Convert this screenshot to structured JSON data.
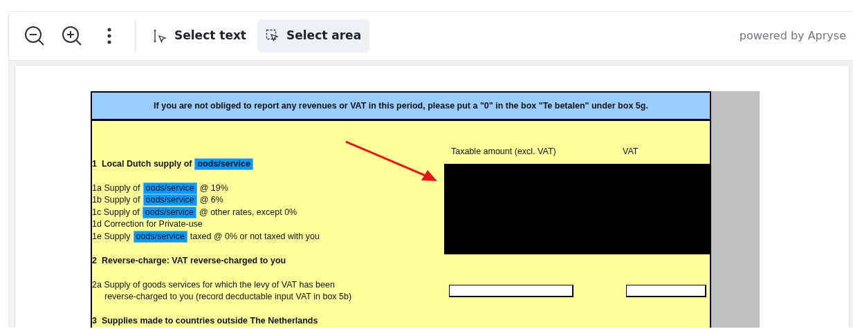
{
  "toolbar": {
    "tools": [
      {
        "label": "Select text",
        "kind": "text",
        "selected": false
      },
      {
        "label": "Select area",
        "kind": "area",
        "selected": true
      }
    ],
    "branding": "powered by Apryse"
  },
  "document": {
    "notice": "If you are not obliged to report any revenues or VAT in this period, please put a \"0\" in the box \"Te betalen\" under box 5g.",
    "columns": [
      "Taxable amount (excl. VAT)",
      "VAT"
    ],
    "redacted": true,
    "items": [
      {
        "kind": "heading",
        "parts": [
          {
            "text": "1  Local Dutch supply of",
            "highlight": false
          },
          {
            "text": "oods/service",
            "highlight": true
          }
        ]
      },
      {
        "kind": "line",
        "parts": [
          {
            "text": "1a Supply of",
            "highlight": false
          },
          {
            "text": "oods/service",
            "highlight": true
          },
          {
            "text": "@ 19%",
            "highlight": false
          }
        ]
      },
      {
        "kind": "line",
        "parts": [
          {
            "text": "1b Supply of",
            "highlight": false
          },
          {
            "text": "oods/service",
            "highlight": true
          },
          {
            "text": "@ 6%",
            "highlight": false
          }
        ]
      },
      {
        "kind": "line",
        "parts": [
          {
            "text": "1c Supply of",
            "highlight": false
          },
          {
            "text": "oods/service",
            "highlight": true
          },
          {
            "text": "@ other rates, except 0%",
            "highlight": false
          }
        ]
      },
      {
        "kind": "line",
        "parts": [
          {
            "text": "1d Correction for Private-use",
            "highlight": false
          }
        ]
      },
      {
        "kind": "line",
        "parts": [
          {
            "text": "1e Supply",
            "highlight": false
          },
          {
            "text": "oods/service",
            "highlight": true
          },
          {
            "text": "taxed @ 0% or not taxed with you",
            "highlight": false
          }
        ]
      },
      {
        "kind": "heading",
        "parts": [
          {
            "text": "2  Reverse-charge: VAT reverse-charged to you",
            "highlight": false
          }
        ]
      },
      {
        "kind": "entry",
        "text": "2a Supply of goods services for which the levy of VAT has been",
        "continuation": "reverse-charged to you (record decductable input VAT in box 5b)"
      },
      {
        "kind": "heading",
        "parts": [
          {
            "text": "3  Supplies made to countries outside The Netherlands",
            "highlight": false
          }
        ]
      }
    ]
  }
}
